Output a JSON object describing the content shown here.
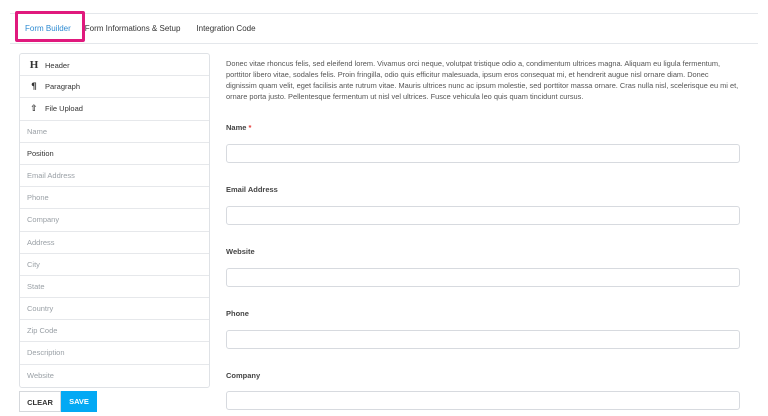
{
  "tabs": [
    {
      "label": "Form Builder"
    },
    {
      "label": "Form Informations & Setup"
    },
    {
      "label": "Integration Code"
    }
  ],
  "palette": {
    "items": [
      {
        "label": "Header",
        "icon": "H"
      },
      {
        "label": "Paragraph",
        "icon": "¶"
      },
      {
        "label": "File Upload",
        "icon": "⇧"
      },
      {
        "label": "Name"
      },
      {
        "label": "Position"
      },
      {
        "label": "Email Address"
      },
      {
        "label": "Phone"
      },
      {
        "label": "Company"
      },
      {
        "label": "Address"
      },
      {
        "label": "City"
      },
      {
        "label": "State"
      },
      {
        "label": "Country"
      },
      {
        "label": "Zip Code"
      },
      {
        "label": "Description"
      },
      {
        "label": "Website"
      }
    ]
  },
  "buttons": {
    "clear": "CLEAR",
    "save": "SAVE"
  },
  "preview": {
    "description": "Donec vitae rhoncus felis, sed eleifend lorem. Vivamus orci neque, volutpat tristique odio a, condimentum ultrices magna. Aliquam eu ligula fermentum, porttitor libero vitae, sodales felis. Proin fringilla, odio quis efficitur malesuada, ipsum eros consequat mi, et hendrerit augue nisl ornare diam. Donec dignissim quam velit, eget facilisis ante rutrum vitae. Mauris ultrices nunc ac ipsum molestie, sed porttitor massa ornare. Cras nulla nisl, scelerisque eu mi et, ornare porta justo. Pellentesque fermentum ut nisl vel ultrices. Fusce vehicula leo quis quam tincidunt cursus.",
    "fields": [
      {
        "label": "Name",
        "required": "*",
        "value": ""
      },
      {
        "label": "Email Address",
        "value": ""
      },
      {
        "label": "Website",
        "value": ""
      },
      {
        "label": "Phone",
        "value": ""
      },
      {
        "label": "Company",
        "value": ""
      }
    ]
  },
  "colors": {
    "accent": "#2e8bd2",
    "save": "#03a9f4",
    "highlight": "#e0197d",
    "required": "#e53935"
  }
}
